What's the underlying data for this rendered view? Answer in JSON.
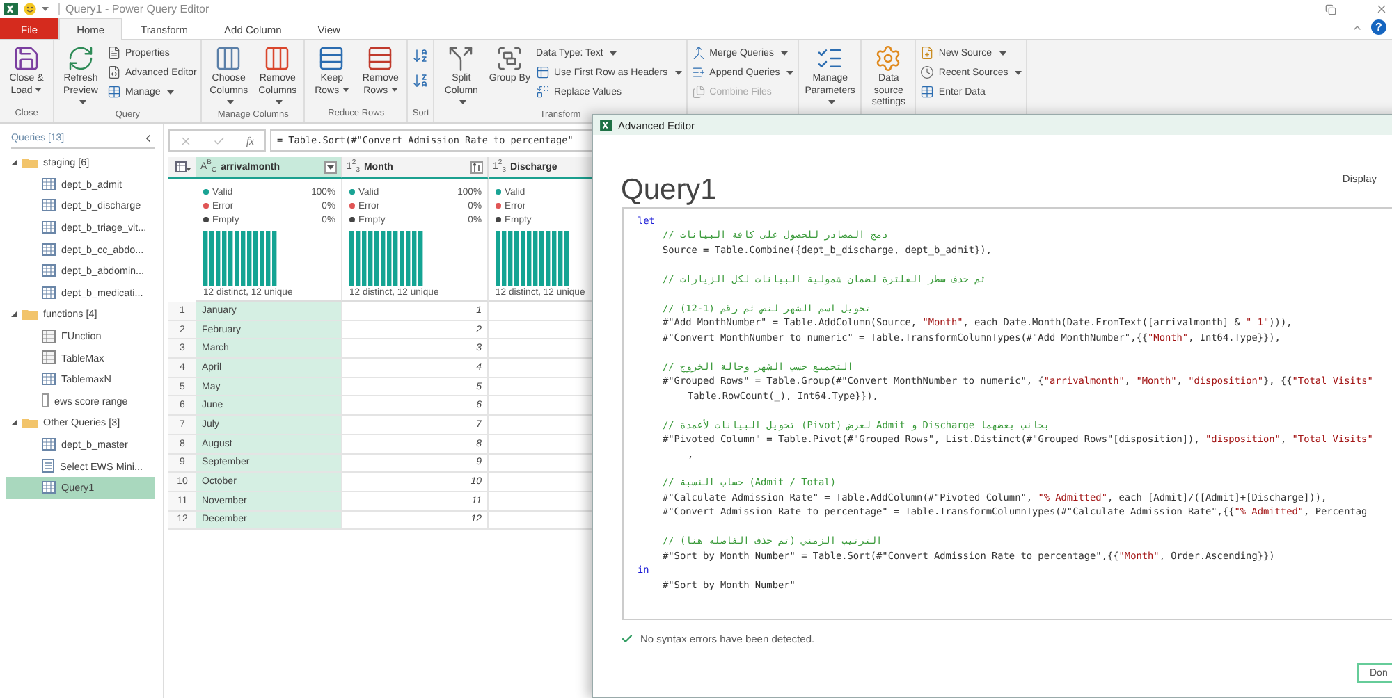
{
  "window": {
    "title": "Query1 - Power Query Editor",
    "help": "?"
  },
  "tabs": [
    {
      "label": "File",
      "kind": "file",
      "selected": false
    },
    {
      "label": "Home",
      "kind": "tab",
      "selected": true
    },
    {
      "label": "Transform",
      "kind": "tab",
      "selected": false
    },
    {
      "label": "Add Column",
      "kind": "tab",
      "selected": false
    },
    {
      "label": "View",
      "kind": "tab",
      "selected": false
    }
  ],
  "ribbon": {
    "groups": [
      {
        "label": "Close",
        "buttons": [
          {
            "kind": "large",
            "label": "Close & Load",
            "dropdown": true,
            "disabled": false
          }
        ]
      },
      {
        "label": "Query",
        "buttons": [
          {
            "kind": "large",
            "label": "Refresh Preview",
            "dropdown": true,
            "disabled": false
          },
          {
            "kind": "small",
            "label": "Properties",
            "dropdown": false,
            "disabled": false
          },
          {
            "kind": "small",
            "label": "Advanced Editor",
            "dropdown": false,
            "disabled": false
          },
          {
            "kind": "small",
            "label": "Manage",
            "dropdown": true,
            "disabled": false
          }
        ]
      },
      {
        "label": "Manage Columns",
        "buttons": [
          {
            "kind": "large",
            "label": "Choose Columns",
            "dropdown": true,
            "disabled": false
          },
          {
            "kind": "large",
            "label": "Remove Columns",
            "dropdown": true,
            "disabled": false
          }
        ]
      },
      {
        "label": "Reduce Rows",
        "buttons": [
          {
            "kind": "large",
            "label": "Keep Rows",
            "dropdown": true,
            "disabled": false
          },
          {
            "kind": "large",
            "label": "Remove Rows",
            "dropdown": true,
            "disabled": false
          }
        ]
      },
      {
        "label": "Sort",
        "buttons": [
          {
            "kind": "icon"
          },
          {
            "kind": "icon"
          }
        ]
      },
      {
        "label": "Transform",
        "buttons": [
          {
            "kind": "large",
            "label": "Split Column",
            "dropdown": true,
            "disabled": false
          },
          {
            "kind": "large",
            "label": "Group By",
            "dropdown": false,
            "disabled": false
          },
          {
            "kind": "text",
            "label": "Data Type: Text",
            "dropdown": true,
            "disabled": false
          },
          {
            "kind": "small",
            "label": "Use First Row as Headers",
            "dropdown": true,
            "disabled": false
          },
          {
            "kind": "small",
            "label": "Replace Values",
            "dropdown": false,
            "disabled": false
          }
        ]
      },
      {
        "buttons": [
          {
            "kind": "small",
            "label": "Merge Queries",
            "dropdown": true,
            "disabled": false
          },
          {
            "kind": "small",
            "label": "Append Queries",
            "dropdown": true,
            "disabled": false
          },
          {
            "kind": "small",
            "label": "Combine Files",
            "dropdown": false,
            "disabled": true
          }
        ]
      },
      {
        "buttons": [
          {
            "kind": "large",
            "label": "Manage Parameters",
            "dropdown": true,
            "disabled": false
          }
        ]
      },
      {
        "buttons": [
          {
            "kind": "large",
            "label": "Data source settings",
            "dropdown": false,
            "disabled": false
          }
        ]
      },
      {
        "buttons": [
          {
            "kind": "small",
            "label": "New Source",
            "dropdown": true,
            "disabled": false
          },
          {
            "kind": "small",
            "label": "Recent Sources",
            "dropdown": true,
            "disabled": false
          },
          {
            "kind": "small",
            "label": "Enter Data",
            "dropdown": false,
            "disabled": false
          }
        ]
      }
    ]
  },
  "queries": {
    "title": "Queries [13]",
    "items": [
      {
        "label": "staging [6]",
        "kind": "folder",
        "expanded": true,
        "selected": false,
        "children": [
          {
            "label": "dept_b_admit",
            "kind": "table",
            "selected": false
          },
          {
            "label": "dept_b_discharge",
            "kind": "table",
            "selected": false
          },
          {
            "label": "dept_b_triage_vit...",
            "kind": "table",
            "selected": false
          },
          {
            "label": "dept_b_cc_abdo...",
            "kind": "table",
            "selected": false
          },
          {
            "label": "dept_b_abdomin...",
            "kind": "table",
            "selected": false
          },
          {
            "label": "dept_b_medicati...",
            "kind": "table",
            "selected": false
          }
        ]
      },
      {
        "label": "functions [4]",
        "kind": "folder",
        "expanded": true,
        "selected": false,
        "children": [
          {
            "label": "FUnction",
            "kind": "function",
            "selected": false
          },
          {
            "label": "TableMax",
            "kind": "function",
            "selected": false
          },
          {
            "label": "TablemaxN",
            "kind": "table",
            "selected": false
          },
          {
            "label": "ews score range",
            "kind": "parameter",
            "selected": false
          }
        ]
      },
      {
        "label": "Other Queries [3]",
        "kind": "folder",
        "expanded": true,
        "selected": false,
        "children": [
          {
            "label": "dept_b_master",
            "kind": "table",
            "selected": false
          },
          {
            "label": "Select EWS Mini...",
            "kind": "list",
            "selected": false
          },
          {
            "label": "Query1",
            "kind": "table",
            "selected": true
          }
        ]
      }
    ]
  },
  "formula_bar": {
    "fx": "fx",
    "formula": "= Table.Sort(#\"Convert Admission Rate to percentage\""
  },
  "table": {
    "columns": [
      {
        "type": "A$^{B}$$_{C}$",
        "name": "arrivalmonth",
        "control": {
          "kind": "filter"
        },
        "selected": true,
        "profile": [
          {
            "kind": "valid",
            "label": "Valid",
            "value": "100%"
          },
          {
            "kind": "error",
            "label": "Error",
            "value": "0%"
          },
          {
            "kind": "empty",
            "label": "Empty",
            "value": "0%"
          }
        ],
        "summary": "12 distinct, 12 unique"
      },
      {
        "type": "1$^{2}$$_{3}$",
        "name": "Month",
        "control": {
          "kind": "sort_ascending"
        },
        "selected": false,
        "profile": [
          {
            "kind": "valid",
            "label": "Valid",
            "value": "100%"
          },
          {
            "kind": "error",
            "label": "Error",
            "value": "0%"
          },
          {
            "kind": "empty",
            "label": "Empty",
            "value": "0%"
          }
        ],
        "summary": "12 distinct, 12 unique"
      },
      {
        "type": "1$^{2}$$_{3}$",
        "name": "Discharge",
        "selected": false,
        "profile": [
          {
            "kind": "valid",
            "label": "Valid"
          },
          {
            "kind": "error",
            "label": "Error"
          },
          {
            "kind": "empty",
            "label": "Empty"
          }
        ],
        "summary": "12 distinct, 12 unique"
      }
    ],
    "rows": [
      {
        "n": "1",
        "cells": [
          "January",
          "1"
        ]
      },
      {
        "n": "2",
        "cells": [
          "February",
          "2"
        ]
      },
      {
        "n": "3",
        "cells": [
          "March",
          "3"
        ]
      },
      {
        "n": "4",
        "cells": [
          "April",
          "4"
        ]
      },
      {
        "n": "5",
        "cells": [
          "May",
          "5"
        ]
      },
      {
        "n": "6",
        "cells": [
          "June",
          "6"
        ]
      },
      {
        "n": "7",
        "cells": [
          "July",
          "7"
        ]
      },
      {
        "n": "8",
        "cells": [
          "August",
          "8"
        ]
      },
      {
        "n": "9",
        "cells": [
          "September",
          "9"
        ]
      },
      {
        "n": "10",
        "cells": [
          "October",
          "10"
        ]
      },
      {
        "n": "11",
        "cells": [
          "November",
          "11"
        ]
      },
      {
        "n": "12",
        "cells": [
          "December",
          "12"
        ]
      }
    ]
  },
  "editor": {
    "title": "Advanced Editor",
    "query": "Query1",
    "display": "Display",
    "lines": [
      {
        "kind": "keyword",
        "text": "let"
      },
      {
        "kind": "comment",
        "text": "// دمج المصادر للحصول على كافة البيانات"
      },
      {
        "kind": "code",
        "text": "Source = Table.Combine({dept_b_discharge, dept_b_admit}),"
      },
      {
        "kind": "blank"
      },
      {
        "kind": "comment",
        "text": "// ثم حذف سطر الفلترة لضمان شمولية البيانات لكل الزيارات"
      },
      {
        "kind": "blank"
      },
      {
        "kind": "comment",
        "text": "// تحويل اسم الشهر لنص ثم رقم (1-12)"
      },
      {
        "kind": "code",
        "text": "#\"Add MonthNumber\" = Table.AddColumn(Source, \"Month\", each Date.Month(Date.FromText([arrivalmonth] & \" 1\"))),"
      },
      {
        "kind": "code",
        "text": "#\"Convert MonthNumber to numeric\" = Table.TransformColumnTypes(#\"Add MonthNumber\",{{\"Month\", Int64.Type}}),"
      },
      {
        "kind": "blank"
      },
      {
        "kind": "comment",
        "text": "// التجميع حسب الشهر وحالة الخروج"
      },
      {
        "kind": "code",
        "text": "#\"Grouped Rows\" = Table.Group(#\"Convert MonthNumber to numeric\", {\"arrivalmonth\", \"Month\", \"disposition\"}, {{\"Total Visits\""
      },
      {
        "kind": "continuation",
        "text": "Table.RowCount(_), Int64.Type}}),"
      },
      {
        "kind": "blank"
      },
      {
        "kind": "comment",
        "text": "// تحويل البيانات لأعمدة (Pivot) لعرض Admit و Discharge بجانب بعضهما"
      },
      {
        "kind": "code",
        "text": "#\"Pivoted Column\" = Table.Pivot(#\"Grouped Rows\", List.Distinct(#\"Grouped Rows\"[disposition]), \"disposition\", \"Total Visits\""
      },
      {
        "kind": "continuation",
        "text": ","
      },
      {
        "kind": "blank"
      },
      {
        "kind": "comment",
        "text": "// حساب النسبة (Admit / Total)"
      },
      {
        "kind": "code",
        "text": "#\"Calculate Admission Rate\" = Table.AddColumn(#\"Pivoted Column\", \"% Admitted\", each [Admit]/([Admit]+[Discharge])),"
      },
      {
        "kind": "code",
        "text": "#\"Convert Admission Rate to percentage\" = Table.TransformColumnTypes(#\"Calculate Admission Rate\",{{\"% Admitted\", Percentag"
      },
      {
        "kind": "blank"
      },
      {
        "kind": "comment",
        "text": "// الترتيب الزمني (تم حذف الفاصلة هنا)"
      },
      {
        "kind": "code",
        "text": "#\"Sort by Month Number\" = Table.Sort(#\"Convert Admission Rate to percentage\",{{\"Month\", Order.Ascending}})"
      },
      {
        "kind": "keyword",
        "text": "in"
      },
      {
        "kind": "code",
        "text": "#\"Sort by Month Number\""
      }
    ],
    "status": "No syntax errors have been detected.",
    "done": "Don"
  }
}
